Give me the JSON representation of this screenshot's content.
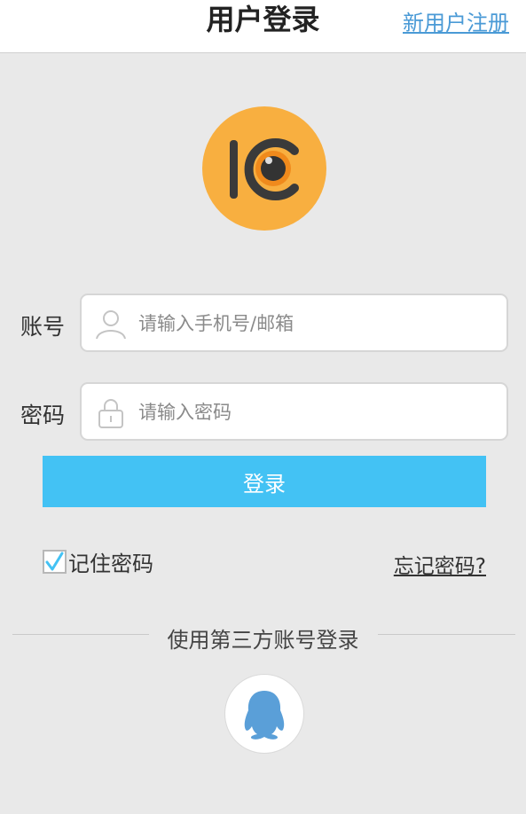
{
  "header": {
    "title": "用户登录",
    "register_link": "新用户注册"
  },
  "logo": {
    "icon": "camera-eye-logo",
    "color": "#f8af40"
  },
  "form": {
    "account": {
      "label": "账号",
      "placeholder": "请输入手机号/邮箱",
      "value": "",
      "icon": "user-icon"
    },
    "password": {
      "label": "密码",
      "placeholder": "请输入密码",
      "value": "",
      "icon": "lock-icon"
    },
    "login_button": "登录",
    "remember": {
      "label": "记住密码",
      "checked": true
    },
    "forgot_link": "忘记密码?"
  },
  "third_party": {
    "label": "使用第三方账号登录",
    "providers": [
      {
        "icon": "qq-icon",
        "color": "#5a9fd8"
      }
    ]
  },
  "colors": {
    "accent": "#43c2f4",
    "link": "#4a9ad6",
    "background": "#e9e9e9"
  }
}
